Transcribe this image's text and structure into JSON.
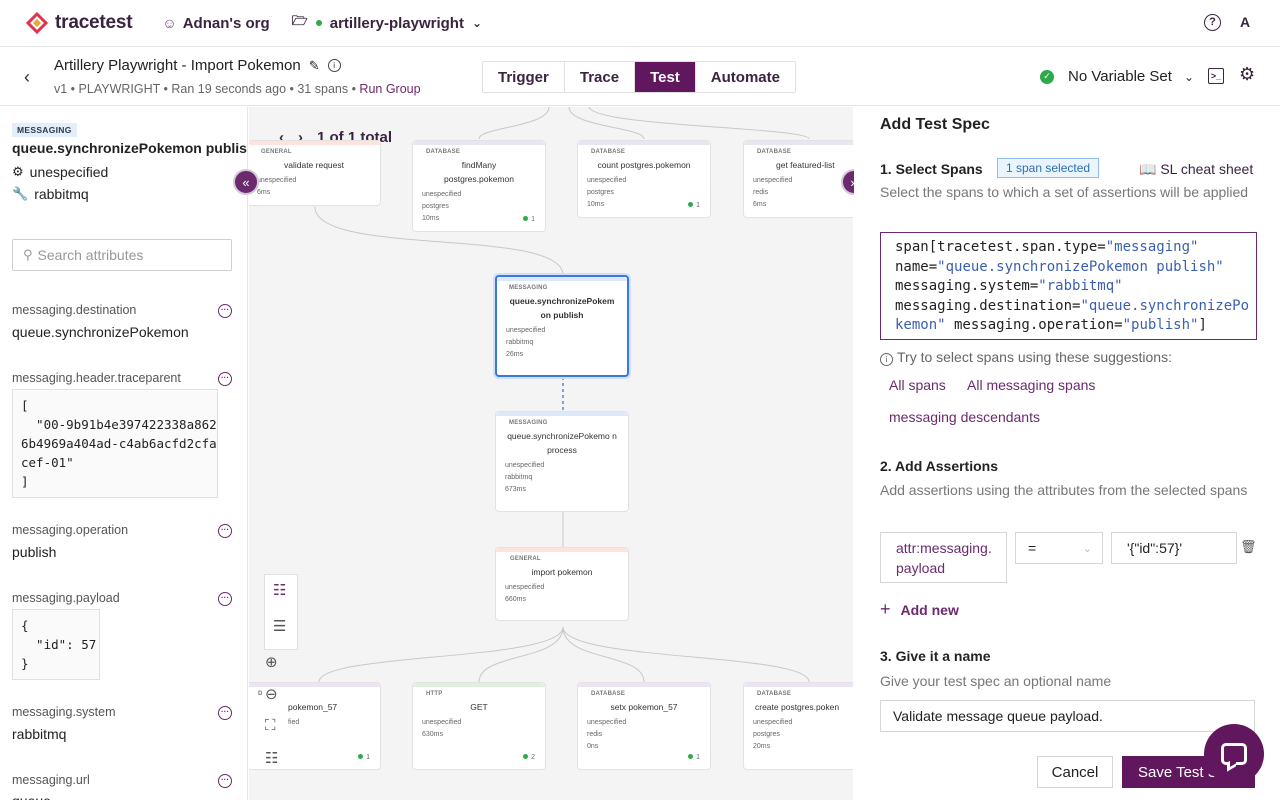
{
  "app": {
    "name": "tracetest"
  },
  "nav": {
    "org": "Adnan's org",
    "project": "artillery-playwright"
  },
  "header": {
    "test_title": "Artillery Playwright - Import Pokemon",
    "version": "v1",
    "type": "PLAYWRIGHT",
    "ran": "Ran 19 seconds ago",
    "spans": "31 spans",
    "run_group": "Run Group",
    "variable_set": "No Variable Set"
  },
  "tabs": [
    "Trigger",
    "Trace",
    "Test",
    "Automate"
  ],
  "left": {
    "kind_badge": "MESSAGING",
    "span_name": "queue.synchronizePokemon publish",
    "service": "unespecified",
    "system": "rabbitmq",
    "search_placeholder": "Search attributes",
    "attributes": [
      {
        "key": "messaging.destination",
        "value": "queue.synchronizePokemon"
      },
      {
        "key": "messaging.header.traceparent",
        "value": "[\n  \"00-9b91b4e397422338a862\n6b4969a404ad-c4ab6acfd2cfa\ncef-01\"\n]"
      },
      {
        "key": "messaging.operation",
        "value": "publish"
      },
      {
        "key": "messaging.payload",
        "value": "{\n  \"id\": 57\n}"
      },
      {
        "key": "messaging.system",
        "value": "rabbitmq"
      },
      {
        "key": "messaging.url",
        "value": "queue"
      }
    ]
  },
  "canvas": {
    "pager": "1 of 1 total",
    "nodes": [
      {
        "tag": "GENERAL",
        "name": "validate request",
        "l1": "unespecified",
        "l2": "",
        "dur": "6ms",
        "count": ""
      },
      {
        "tag": "DATABASE",
        "name": "findMany postgres.pokemon",
        "l1": "unespecified",
        "l2": "postgres",
        "dur": "10ms",
        "count": "1"
      },
      {
        "tag": "DATABASE",
        "name": "count postgres.pokemon",
        "l1": "unespecified",
        "l2": "postgres",
        "dur": "10ms",
        "count": "1"
      },
      {
        "tag": "DATABASE",
        "name": "get featured-list",
        "l1": "unespecified",
        "l2": "redis",
        "dur": "6ms",
        "count": ""
      },
      {
        "tag": "MESSAGING",
        "name": "queue.synchronizePokem on publish",
        "l1": "unespecified",
        "l2": "rabbitmq",
        "dur": "26ms",
        "count": ""
      },
      {
        "tag": "MESSAGING",
        "name": "queue.synchronizePokemo n process",
        "l1": "unespecified",
        "l2": "rabbitmq",
        "dur": "673ms",
        "count": ""
      },
      {
        "tag": "GENERAL",
        "name": "import pokemon",
        "l1": "unespecified",
        "l2": "",
        "dur": "660ms",
        "count": ""
      },
      {
        "tag": "DATABASE",
        "name": "pokemon_57",
        "l1": "fied",
        "l2": "",
        "dur": "",
        "count": "1"
      },
      {
        "tag": "HTTP",
        "name": "GET",
        "l1": "unespecified",
        "l2": "",
        "dur": "630ms",
        "count": "2"
      },
      {
        "tag": "DATABASE",
        "name": "setx pokemon_57",
        "l1": "unespecified",
        "l2": "redis",
        "dur": "0ns",
        "count": "1"
      },
      {
        "tag": "DATABASE",
        "name": "create postgres.poken",
        "l1": "unespecified",
        "l2": "postgres",
        "dur": "20ms",
        "count": ""
      }
    ]
  },
  "right": {
    "title": "Add Test Spec",
    "s1_title": "1. Select Spans",
    "s1_pill": "1 span selected",
    "cheat": "SL cheat sheet",
    "s1_desc": "Select the spans to which a set of assertions will be applied",
    "selector": {
      "a": "span[tracetest.span.type=",
      "b": "\"messaging\"",
      "c": "name=",
      "d": "\"queue.synchronizePokemon publish\"",
      "e": "messaging.system=",
      "f": "\"rabbitmq\"",
      "g": "messaging.destination=",
      "h": "\"queue.synchronizePo",
      "i": "kemon\"",
      "j": " messaging.operation=",
      "k": "\"publish\"",
      "l": "]"
    },
    "sugg_label": "Try to select spans using these suggestions:",
    "suggestions": [
      "All spans",
      "All messaging spans",
      "messaging descendants"
    ],
    "s2_title": "2. Add Assertions",
    "s2_desc": "Add assertions using the attributes from the selected spans",
    "assertion": {
      "attr": "attr:messaging. payload",
      "op": "=",
      "value": "'{\"id\":57}'"
    },
    "add_new": "Add new",
    "s3_title": "3. Give it a name",
    "s3_desc": "Give your test spec an optional name",
    "name_value": "Validate message queue payload.",
    "cancel": "Cancel",
    "save": "Save Test Spec"
  },
  "colors": {
    "brand": "#61175e",
    "accent": "#6b2a6e",
    "success": "#2eaa4a",
    "selected": "#3a78e0"
  }
}
